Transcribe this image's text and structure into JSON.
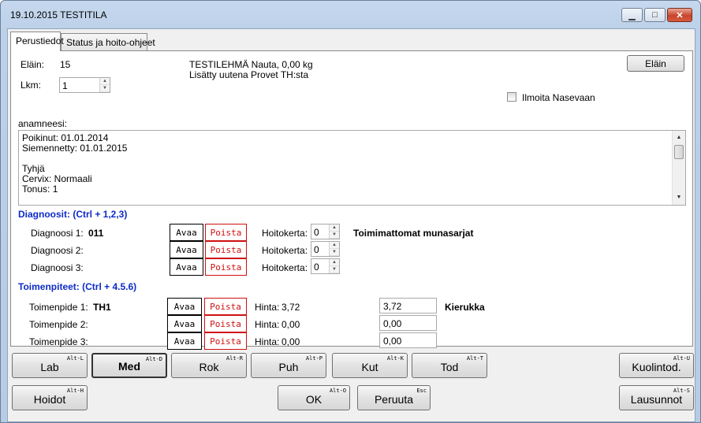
{
  "window": {
    "title": "19.10.2015 TESTITILA",
    "min": "▁",
    "max": "□",
    "close": "✕"
  },
  "tabs": [
    "Perustiedot",
    "Status ja hoito-ohjeet"
  ],
  "animal": {
    "label": "Eläin:",
    "value": "15",
    "desc": "TESTILEHMÄ Nauta,  0,00 kg",
    "added": "Lisätty uutena Provet TH:sta",
    "button": "Eläin"
  },
  "lkm": {
    "label": "Lkm:",
    "value": "1"
  },
  "nasevaan": "Ilmoita Nasevaan",
  "anamneesi": {
    "label": "anamneesi:",
    "lines": [
      "Poikinut: 01.01.2014",
      "Siemennetty: 01.01.2015",
      "",
      "Tyhjä",
      "Cervix: Normaali",
      "Tonus: 1"
    ]
  },
  "diagnoses": {
    "header": "Diagnoosit: (Ctrl + 1,2,3)",
    "open": "Avaa",
    "remove": "Poista",
    "hoitokerta_label": "Hoitokerta:",
    "rows": [
      {
        "label": "Diagnoosi 1:",
        "code": "011",
        "hoitokerta": "0",
        "desc": "Toimimattomat munasarjat"
      },
      {
        "label": "Diagnoosi 2:",
        "code": "",
        "hoitokerta": "0",
        "desc": ""
      },
      {
        "label": "Diagnoosi 3:",
        "code": "",
        "hoitokerta": "0",
        "desc": ""
      }
    ]
  },
  "procedures": {
    "header": "Toimenpiteet: (Ctrl + 4.5.6)",
    "open": "Avaa",
    "remove": "Poista",
    "hinta_label": "Hinta:",
    "rows": [
      {
        "label": "Toimenpide 1:",
        "code": "TH1",
        "hinta": "3,72",
        "value": "3,72",
        "desc": "Kierukka"
      },
      {
        "label": "Toimenpide 2:",
        "code": "",
        "hinta": "0,00",
        "value": "0,00",
        "desc": ""
      },
      {
        "label": "Toimenpide 3:",
        "code": "",
        "hinta": "0,00",
        "value": "0,00",
        "desc": ""
      }
    ]
  },
  "bottom": {
    "lab": {
      "label": "Lab",
      "key": "Alt-L"
    },
    "med": {
      "label": "Med",
      "key": "Alt-D"
    },
    "rok": {
      "label": "Rok",
      "key": "Alt-R"
    },
    "puh": {
      "label": "Puh",
      "key": "Alt-P"
    },
    "kut": {
      "label": "Kut",
      "key": "Alt-K"
    },
    "tod": {
      "label": "Tod",
      "key": "Alt-T"
    },
    "kuolintod": {
      "label": "Kuolintod.",
      "key": "Alt-U"
    },
    "hoidot": {
      "label": "Hoidot",
      "key": "Alt-H"
    },
    "ok": {
      "label": "OK",
      "key": "Alt-O"
    },
    "peruuta": {
      "label": "Peruuta",
      "key": "Esc"
    },
    "lausunnot": {
      "label": "Lausunnot",
      "key": "Alt-S"
    }
  }
}
